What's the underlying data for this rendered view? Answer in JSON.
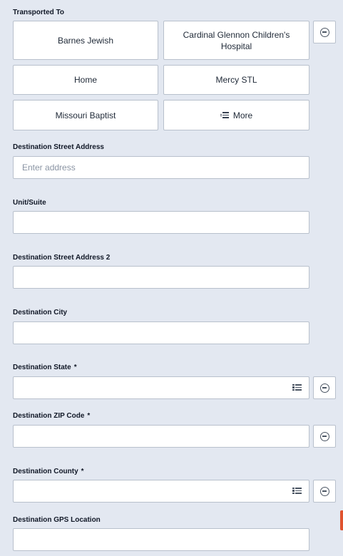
{
  "transported_to": {
    "label": "Transported To",
    "options": [
      {
        "label": "Barnes Jewish"
      },
      {
        "label": "Cardinal Glennon Children's Hospital"
      },
      {
        "label": "Home"
      },
      {
        "label": "Mercy STL"
      },
      {
        "label": "Missouri Baptist"
      },
      {
        "label": "More",
        "icon": "list-icon"
      }
    ],
    "clear_icon": "minus-circle-icon"
  },
  "fields": [
    {
      "label": "Destination Street Address",
      "value": "",
      "placeholder": "Enter address",
      "required": false
    },
    {
      "label": "Unit/Suite",
      "value": "",
      "placeholder": "",
      "required": false
    },
    {
      "label": "Destination Street Address 2",
      "value": "",
      "placeholder": "",
      "required": false
    },
    {
      "label": "Destination City",
      "value": "",
      "placeholder": "",
      "required": false
    },
    {
      "label": "Destination State",
      "value": "",
      "placeholder": "",
      "required": true,
      "required_mark": "*",
      "picker_icon": "list-icon",
      "clear_icon": "minus-circle-icon"
    },
    {
      "label": "Destination ZIP Code",
      "value": "",
      "placeholder": "",
      "required": true,
      "required_mark": "*",
      "clear_icon": "minus-circle-icon"
    },
    {
      "label": "Destination County",
      "value": "",
      "placeholder": "",
      "required": true,
      "required_mark": "*",
      "picker_icon": "list-icon",
      "clear_icon": "minus-circle-icon"
    },
    {
      "label": "Destination GPS Location",
      "value": "",
      "placeholder": "",
      "required": false
    }
  ],
  "colors": {
    "background": "#e3e8f1",
    "border": "#b8c0cc",
    "accent": "#e0532f"
  }
}
